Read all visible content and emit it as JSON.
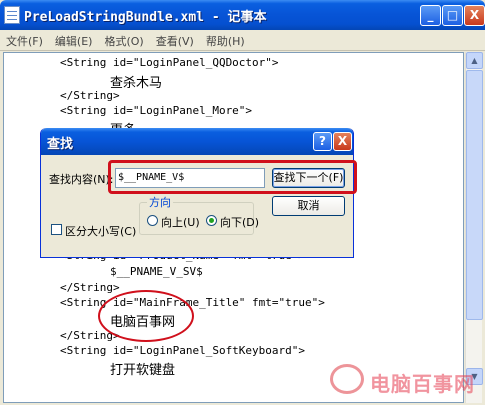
{
  "window": {
    "title": "PreLoadStringBundle.xml - 记事本",
    "minimize_glyph": "_",
    "maximize_glyph": "□",
    "close_glyph": "X"
  },
  "menu": [
    "文件(F)",
    "编辑(E)",
    "格式(O)",
    "查看(V)",
    "帮助(H)"
  ],
  "editor_lines": [
    "<String id=\"LoginPanel_QQDoctor\">",
    "查杀木马",
    "</String>",
    "<String id=\"LoginPanel_More\">",
    "更多",
    "<String id=\"Product_Name\" fmt=\"true\">",
    "$__PNAME_V_SV$",
    "</String>",
    "<String id=\"MainFrame_Title\" fmt=\"true\">",
    "电脑百事网",
    "</String>",
    "<String id=\"LoginPanel_SoftKeyboard\">",
    "打开软键盘"
  ],
  "dialog": {
    "title": "查找",
    "help_glyph": "?",
    "close_glyph": "X",
    "find_label": "查找内容(N):",
    "find_value": "$__PNAME_V$",
    "find_next_label": "查找下一个(F)",
    "cancel_label": "取消",
    "direction_label": "方向",
    "up_label": "向上(U)",
    "down_label": "向下(D)",
    "direction_selected": "down",
    "match_case_label": "区分大小写(C)",
    "match_case_checked": false
  },
  "scrollbar": {
    "up_glyph": "▲",
    "down_glyph": "▼"
  },
  "watermark": {
    "text": "电脑百事网"
  },
  "colors": {
    "title_blue": "#0754d6",
    "annotation_red": "#d0101c"
  }
}
